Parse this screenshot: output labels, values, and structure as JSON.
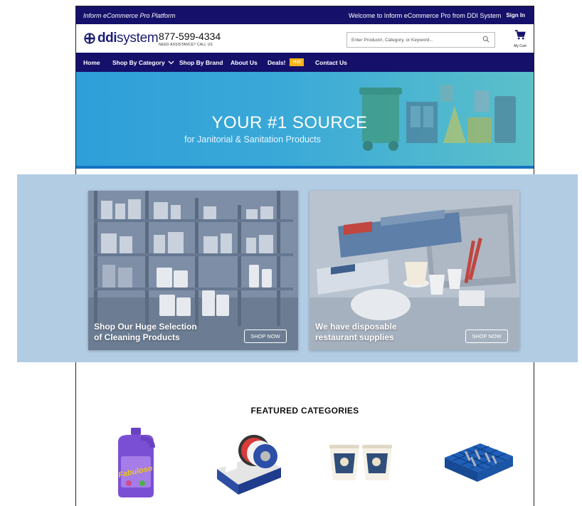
{
  "topbar": {
    "platform": "Inform eCommerce Pro Platform",
    "welcome": "Welcome to Inform eCommerce Pro from DDI System",
    "signin": "Sign In"
  },
  "header": {
    "logo_ddi": "ddi",
    "logo_system": "system",
    "phone": "877-599-4334",
    "assistance": "NEED ASSISTANCE? CALL US",
    "search_placeholder": "Enter Product#, Category, or Keyword...",
    "cart_label": "My Cart",
    "icons": [
      "globe-logo-icon",
      "search-icon",
      "cart-icon"
    ]
  },
  "nav": {
    "items": [
      "Home",
      "Shop By Category",
      "Shop By Brand",
      "About Us",
      "Deals!",
      "Contact Us"
    ],
    "hot_badge": "Hot"
  },
  "hero": {
    "title": "YOUR #1 SOURCE",
    "subtitle": "for Janitorial & Sanitation Products"
  },
  "promos": [
    {
      "label_line1": "Shop Our Huge Selection",
      "label_line2": "of Cleaning Products",
      "button": "SHOP NOW"
    },
    {
      "label_line1": "We have disposable",
      "label_line2": "restaurant supplies",
      "button": "SHOP NOW"
    }
  ],
  "featured": {
    "title": "FEATURED CATEGORIES",
    "items": [
      {
        "name": "cleaner-bottle-image",
        "bottle_label": "Fabuloso"
      },
      {
        "name": "tape-dispenser-image"
      },
      {
        "name": "paper-cups-image"
      },
      {
        "name": "dish-rack-image"
      }
    ]
  },
  "colors": {
    "nav_bg": "#15106a",
    "hero_bg": "#3aa9d8",
    "hot_badge": "#f7b41b",
    "promo_band": "#b2cce4"
  }
}
